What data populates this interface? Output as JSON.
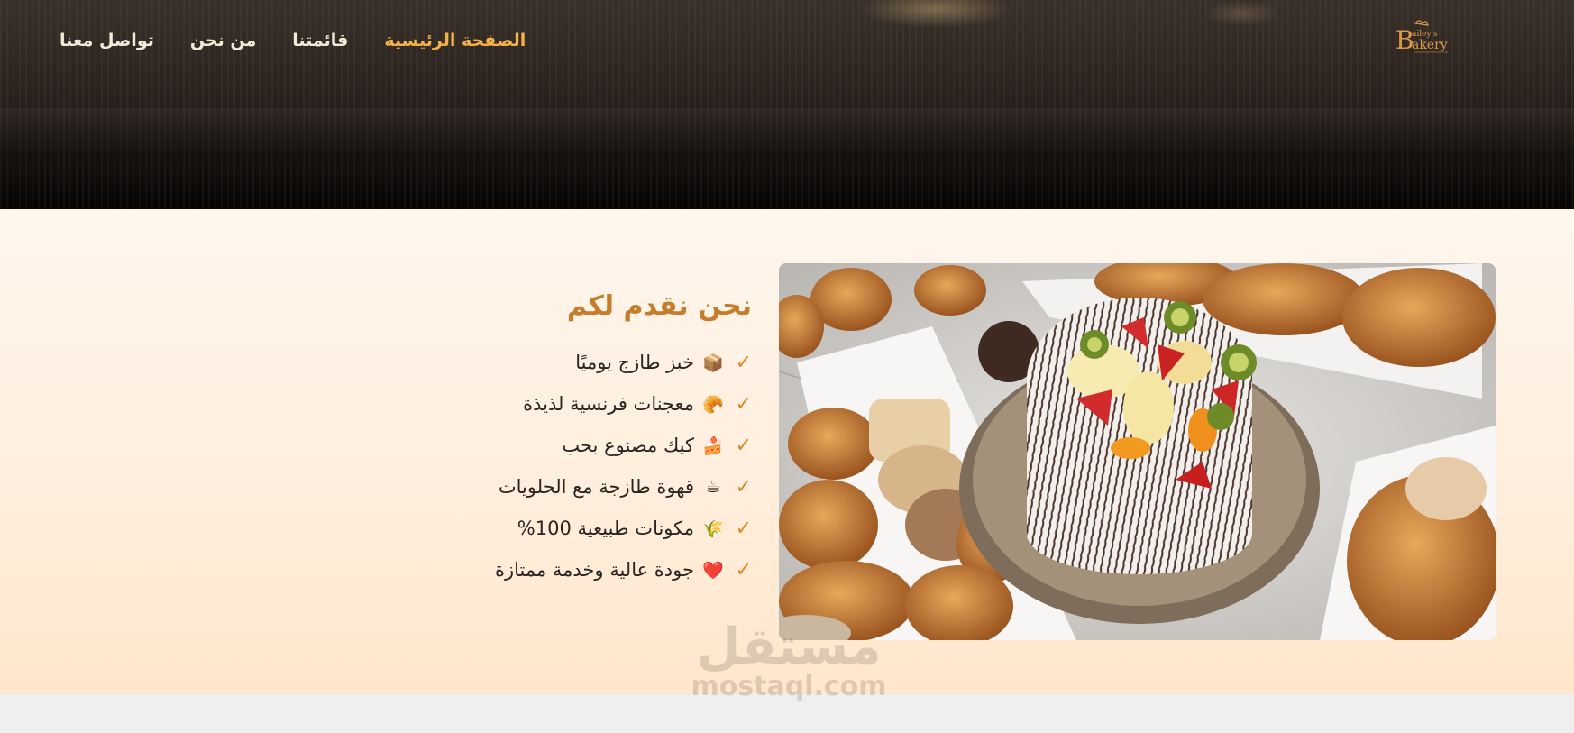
{
  "nav": {
    "items": [
      {
        "label": "الصفحة الرئيسية",
        "active": true
      },
      {
        "label": "قائمتنا",
        "active": false
      },
      {
        "label": "من نحن",
        "active": false
      },
      {
        "label": "تواصل معنا",
        "active": false
      }
    ]
  },
  "logo": {
    "text_small": "ailey's",
    "text_big": "akery",
    "initial": "B"
  },
  "section": {
    "title": "نحن نقدم لكم",
    "features": [
      {
        "emoji": "📦",
        "text": "خبز طازج يوميًا"
      },
      {
        "emoji": "🥐",
        "text": "معجنات فرنسية لذيذة"
      },
      {
        "emoji": "🍰",
        "text": "كيك مصنوع بحب"
      },
      {
        "emoji": "☕",
        "text": "قهوة طازجة مع الحلويات"
      },
      {
        "emoji": "🌾",
        "text": "مكونات طبيعية 100%"
      },
      {
        "emoji": "❤️",
        "text": "جودة عالية وخدمة ممتازة"
      }
    ],
    "check_symbol": "✓"
  },
  "watermark": {
    "arabic": "مستقل",
    "latin": "mostaql.com"
  },
  "colors": {
    "accent": "#c57d2c",
    "nav_active": "#f2b24a",
    "check": "#d98a26"
  }
}
